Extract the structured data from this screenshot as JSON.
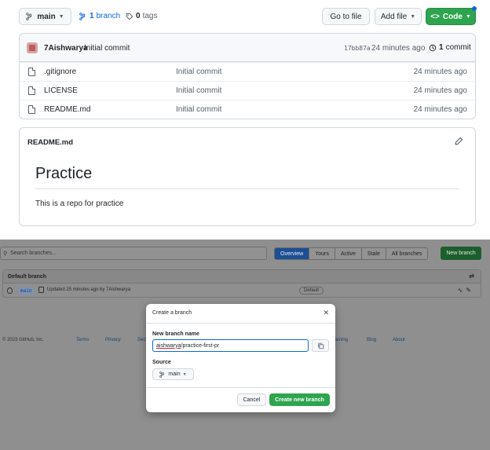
{
  "repo_header": {
    "branch_selector": "main",
    "branch_count": "1",
    "branch_word": "branch",
    "tag_count": "0",
    "tag_word": "tags",
    "goto_file": "Go to file",
    "add_file": "Add file",
    "code": "Code"
  },
  "commit": {
    "author": "7Aishwarya",
    "message": "Initial commit",
    "hash": "17bb87a",
    "time": "24 minutes ago",
    "count": "1",
    "count_word": "commit"
  },
  "files": [
    {
      "name": ".gitignore",
      "message": "Initial commit",
      "time": "24 minutes ago"
    },
    {
      "name": "LICENSE",
      "message": "Initial commit",
      "time": "24 minutes ago"
    },
    {
      "name": "README.md",
      "message": "Initial commit",
      "time": "24 minutes ago"
    }
  ],
  "readme": {
    "filename": "README.md",
    "heading": "Practice",
    "body": "This is a repo for practice"
  },
  "branches_page": {
    "search_placeholder": "Search branches...",
    "tabs": [
      "Overview",
      "Yours",
      "Active",
      "Stale",
      "All branches"
    ],
    "new_branch": "New branch",
    "default_header": "Default branch",
    "default_name": "main",
    "default_updated": "Updated 25 minutes ago by 7Aishwarya",
    "default_badge": "Default",
    "footer": {
      "copyright": "© 2023 GitHub, Inc.",
      "terms": "Terms",
      "privacy": "Privacy",
      "sec": "Sec",
      "training": "aining",
      "blog": "Blog",
      "about": "About"
    }
  },
  "modal": {
    "title": "Create a branch",
    "name_label": "New branch name",
    "input_prefix": "aishwarya",
    "input_rest": "/practice-first-pr",
    "source_label": "Source",
    "source_value": "main",
    "cancel": "Cancel",
    "create": "Create new branch"
  }
}
